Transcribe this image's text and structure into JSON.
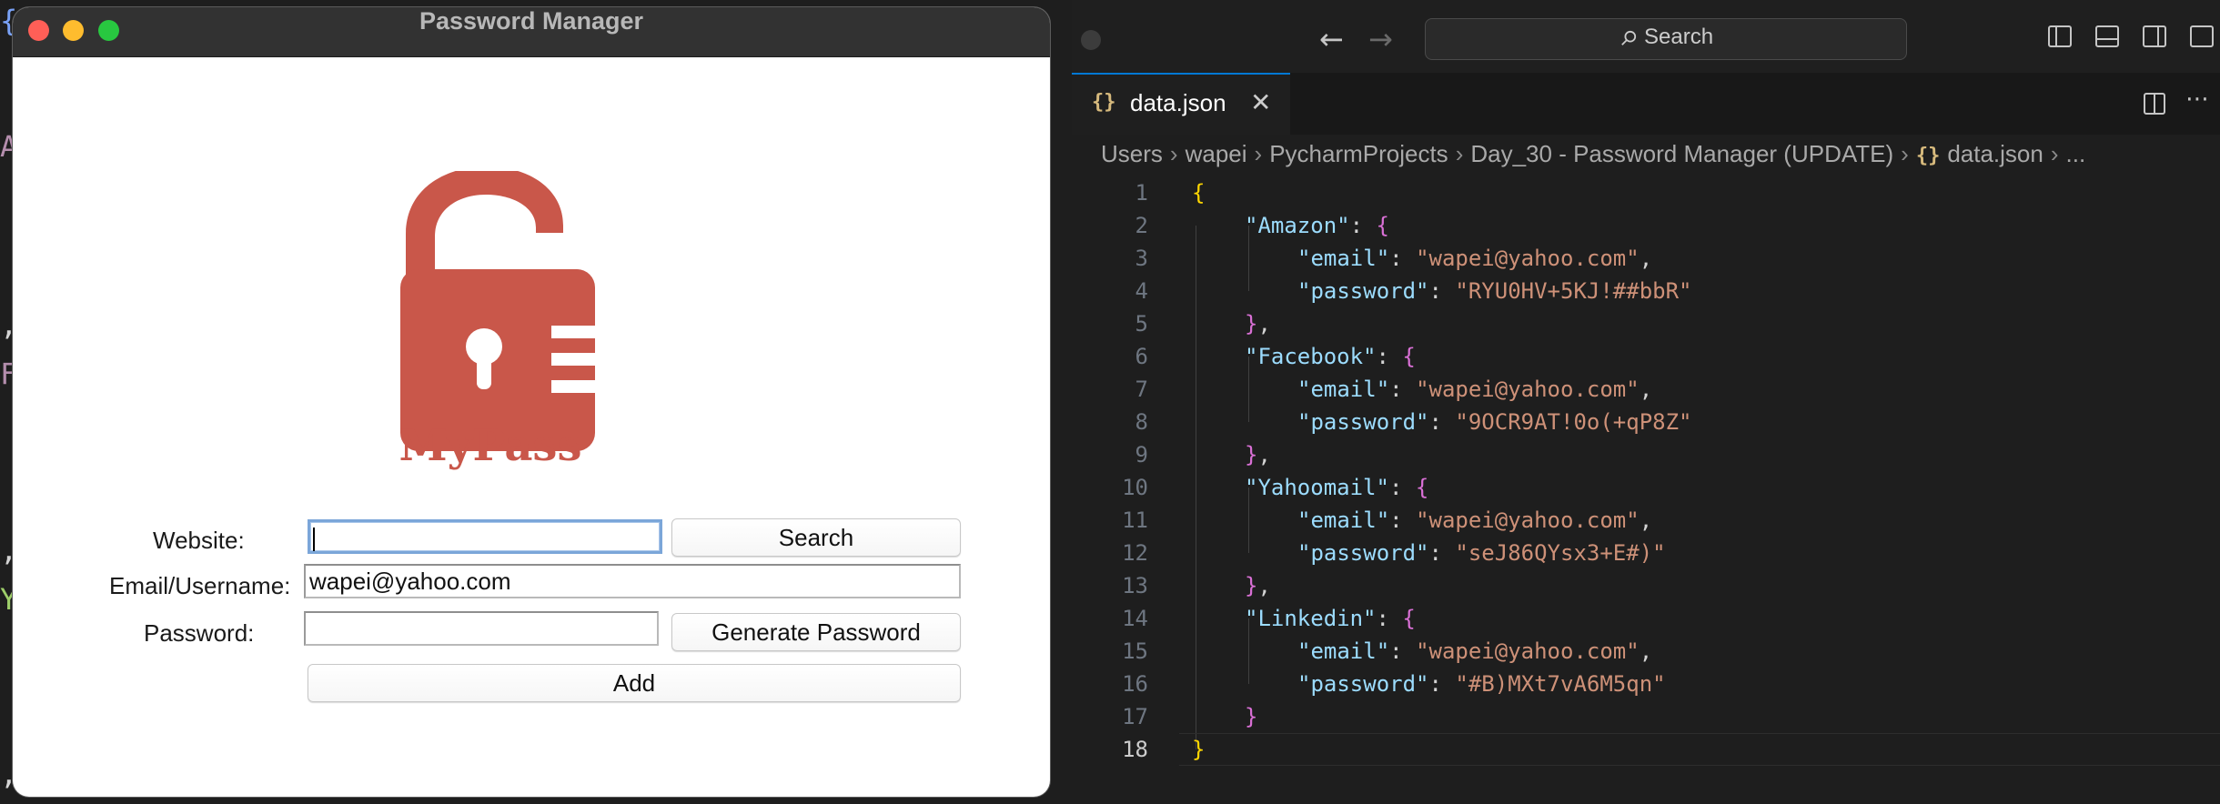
{
  "bg_chars": [
    "{",
    "A",
    ",",
    "F",
    ",",
    "Y",
    ","
  ],
  "tk_window": {
    "title": "Password Manager",
    "logo_text": "MyPass",
    "website_label": "Website:",
    "website_value": "",
    "search_button": "Search",
    "email_label": "Email/Username:",
    "email_value": "wapei@yahoo.com",
    "password_label": "Password:",
    "password_value": "",
    "generate_button": "Generate Password",
    "add_button": "Add"
  },
  "vscode": {
    "search_placeholder": "Search",
    "tab_icon": "{}",
    "tab_label": "data.json",
    "breadcrumb": [
      "Users",
      "wapei",
      "PycharmProjects",
      "Day_30 - Password Manager (UPDATE)",
      "data.json",
      "..."
    ],
    "breadcrumb_icon": "{}",
    "current_line": 18,
    "lines": [
      {
        "n": "1",
        "indent": 0,
        "tokens": [
          {
            "t": "{",
            "c": "b1"
          }
        ]
      },
      {
        "n": "2",
        "indent": 1,
        "tokens": [
          {
            "t": "\"Amazon\"",
            "c": "k"
          },
          {
            "t": ": ",
            "c": "p"
          },
          {
            "t": "{",
            "c": "b2"
          }
        ]
      },
      {
        "n": "3",
        "indent": 2,
        "tokens": [
          {
            "t": "\"email\"",
            "c": "k"
          },
          {
            "t": ": ",
            "c": "p"
          },
          {
            "t": "\"wapei@yahoo.com\"",
            "c": "s"
          },
          {
            "t": ",",
            "c": "p"
          }
        ]
      },
      {
        "n": "4",
        "indent": 2,
        "tokens": [
          {
            "t": "\"password\"",
            "c": "k"
          },
          {
            "t": ": ",
            "c": "p"
          },
          {
            "t": "\"RYU0HV+5KJ!##bbR\"",
            "c": "s"
          }
        ]
      },
      {
        "n": "5",
        "indent": 1,
        "tokens": [
          {
            "t": "}",
            "c": "b2"
          },
          {
            "t": ",",
            "c": "p"
          }
        ]
      },
      {
        "n": "6",
        "indent": 1,
        "tokens": [
          {
            "t": "\"Facebook\"",
            "c": "k"
          },
          {
            "t": ": ",
            "c": "p"
          },
          {
            "t": "{",
            "c": "b2"
          }
        ]
      },
      {
        "n": "7",
        "indent": 2,
        "tokens": [
          {
            "t": "\"email\"",
            "c": "k"
          },
          {
            "t": ": ",
            "c": "p"
          },
          {
            "t": "\"wapei@yahoo.com\"",
            "c": "s"
          },
          {
            "t": ",",
            "c": "p"
          }
        ]
      },
      {
        "n": "8",
        "indent": 2,
        "tokens": [
          {
            "t": "\"password\"",
            "c": "k"
          },
          {
            "t": ": ",
            "c": "p"
          },
          {
            "t": "\"9OCR9AT!0o(+qP8Z\"",
            "c": "s"
          }
        ]
      },
      {
        "n": "9",
        "indent": 1,
        "tokens": [
          {
            "t": "}",
            "c": "b2"
          },
          {
            "t": ",",
            "c": "p"
          }
        ]
      },
      {
        "n": "10",
        "indent": 1,
        "tokens": [
          {
            "t": "\"Yahoomail\"",
            "c": "k"
          },
          {
            "t": ": ",
            "c": "p"
          },
          {
            "t": "{",
            "c": "b2"
          }
        ]
      },
      {
        "n": "11",
        "indent": 2,
        "tokens": [
          {
            "t": "\"email\"",
            "c": "k"
          },
          {
            "t": ": ",
            "c": "p"
          },
          {
            "t": "\"wapei@yahoo.com\"",
            "c": "s"
          },
          {
            "t": ",",
            "c": "p"
          }
        ]
      },
      {
        "n": "12",
        "indent": 2,
        "tokens": [
          {
            "t": "\"password\"",
            "c": "k"
          },
          {
            "t": ": ",
            "c": "p"
          },
          {
            "t": "\"seJ86QYsx3+E#)\"",
            "c": "s"
          }
        ]
      },
      {
        "n": "13",
        "indent": 1,
        "tokens": [
          {
            "t": "}",
            "c": "b2"
          },
          {
            "t": ",",
            "c": "p"
          }
        ]
      },
      {
        "n": "14",
        "indent": 1,
        "tokens": [
          {
            "t": "\"Linkedin\"",
            "c": "k"
          },
          {
            "t": ": ",
            "c": "p"
          },
          {
            "t": "{",
            "c": "b2"
          }
        ]
      },
      {
        "n": "15",
        "indent": 2,
        "tokens": [
          {
            "t": "\"email\"",
            "c": "k"
          },
          {
            "t": ": ",
            "c": "p"
          },
          {
            "t": "\"wapei@yahoo.com\"",
            "c": "s"
          },
          {
            "t": ",",
            "c": "p"
          }
        ]
      },
      {
        "n": "16",
        "indent": 2,
        "tokens": [
          {
            "t": "\"password\"",
            "c": "k"
          },
          {
            "t": ": ",
            "c": "p"
          },
          {
            "t": "\"#B)MXt7vA6M5qn\"",
            "c": "s"
          }
        ]
      },
      {
        "n": "17",
        "indent": 1,
        "tokens": [
          {
            "t": "}",
            "c": "b2"
          }
        ]
      },
      {
        "n": "18",
        "indent": 0,
        "tokens": [
          {
            "t": "}",
            "c": "b1"
          }
        ]
      }
    ]
  },
  "colors": {
    "logo_red": "#c9574a",
    "accent_blue": "#0078d4",
    "key": "#9cdcfe",
    "string": "#ce9178",
    "bracket_outer": "#ffd700",
    "bracket_inner": "#da70d6"
  }
}
